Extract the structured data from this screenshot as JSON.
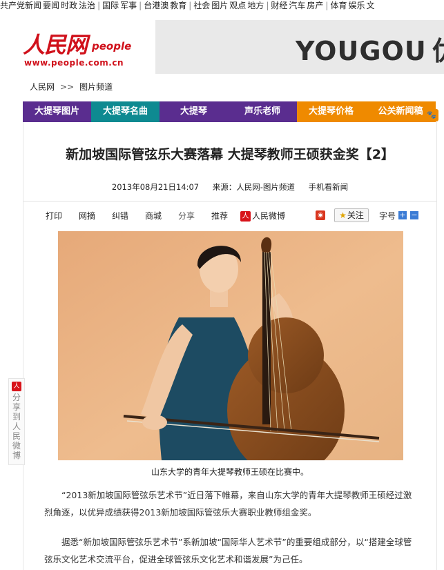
{
  "top_nav": {
    "groups": [
      [
        "共产党新闻",
        "要闻",
        "时政",
        "法治"
      ],
      [
        "国际",
        "军事"
      ],
      [
        "台港澳",
        "教育"
      ],
      [
        "社会",
        "图片",
        "观点",
        "地方"
      ],
      [
        "财经",
        "汽车",
        "房产"
      ],
      [
        "体育",
        "娱乐",
        "文"
      ]
    ]
  },
  "logo": {
    "main": "人民网",
    "latin": "people",
    "url": "www.people.com.cn"
  },
  "ad": {
    "text_1": "YOUGOU",
    "text_2": "优"
  },
  "breadcrumb": {
    "home": "人民网",
    "arrow": ">>",
    "section": "图片频道"
  },
  "categories": [
    {
      "label": "大提琴图片",
      "color": "#5a2d8f"
    },
    {
      "label": "大提琴名曲",
      "color": "#0e8a91"
    },
    {
      "label": "大提琴",
      "color": "#5a2d8f"
    },
    {
      "label": "声乐老师",
      "color": "#5a2d8f"
    },
    {
      "label": "大提琴价格",
      "color": "#ef8a00"
    },
    {
      "label": "公关新闻稿",
      "color": "#ef8a00"
    }
  ],
  "article": {
    "title": "新加坡国际管弦乐大赛落幕 大提琴教师王硕获金奖【2】",
    "date": "2013年08月21日14:07",
    "source": "来源：人民网-图片频道",
    "mobile": "手机看新闻"
  },
  "tools": {
    "print": "打印",
    "netclip": "网摘",
    "correct": "纠错",
    "mall": "商城",
    "share": "分享",
    "recommend": "推荐",
    "weibo": "人民微博",
    "follow": "关注",
    "font_size": "字号"
  },
  "photo": {
    "caption": "山东大学的青年大提琴教师王硕在比赛中。"
  },
  "paragraphs": [
    "“2013新加坡国际管弦乐艺术节”近日落下帷幕，来自山东大学的青年大提琴教师王硕经过激烈角逐，以优异成绩获得2013新加坡国际管弦乐大赛职业教师组金奖。",
    "据悉“新加坡国际管弦乐艺术节”系新加坡“国际华人艺术节”的重要组成部分，以“搭建全球管弦乐文化艺术交流平台，促进全球管弦乐文化艺术和谐发展”为己任。"
  ],
  "share_sidebar": {
    "text": "分享到人民微博"
  }
}
